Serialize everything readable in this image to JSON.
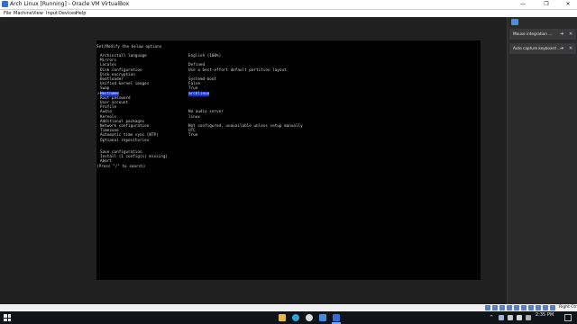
{
  "window": {
    "title": "Arch Linux [Running] - Oracle VM VirtualBox",
    "controls": [
      "—",
      "❐",
      "✕"
    ]
  },
  "menubar": {
    "items": [
      "File",
      "Machine",
      "View",
      "Input",
      "Devices",
      "Help"
    ]
  },
  "console": {
    "header": "Set/Modify the below options",
    "selected_index": 8,
    "options": [
      {
        "label": "Archinstall language",
        "value": "English (100%)"
      },
      {
        "label": "Mirrors",
        "value": ""
      },
      {
        "label": "Locales",
        "value": "Defined"
      },
      {
        "label": "Disk configuration",
        "value": "Use a best-effort default partition layout"
      },
      {
        "label": "Disk encryption",
        "value": ""
      },
      {
        "label": "Bootloader",
        "value": "Systemd-boot"
      },
      {
        "label": "Unified kernel images",
        "value": "False"
      },
      {
        "label": "Swap",
        "value": "True"
      },
      {
        "label": "Hostname",
        "value": "archlinux"
      },
      {
        "label": "Root password",
        "value": ""
      },
      {
        "label": "User account",
        "value": ""
      },
      {
        "label": "Profile",
        "value": ""
      },
      {
        "label": "Audio",
        "value": "No audio server"
      },
      {
        "label": "Kernels",
        "value": "linux"
      },
      {
        "label": "Additional packages",
        "value": ""
      },
      {
        "label": "Network configuration",
        "value": "Not configured, unavailable unless setup manually"
      },
      {
        "label": "Timezone",
        "value": "UTC"
      },
      {
        "label": "Automatic time sync (NTP)",
        "value": "True"
      },
      {
        "label": "Optional repositories",
        "value": ""
      }
    ],
    "actions": [
      "Save configuration",
      "Install (1 config(s) missing)",
      "Abort"
    ],
    "search_hint": "(Press \"/\" to search)",
    "cursor": ">"
  },
  "side_panel": {
    "notifications": [
      {
        "text": "Mouse integration ..."
      },
      {
        "text": "Auto capture keyboard ..."
      }
    ]
  },
  "statusbar": {
    "host_key": "Right Ctrl"
  },
  "taskbar": {
    "tray_arrow": "^",
    "clock_time": "2:35 PM"
  }
}
